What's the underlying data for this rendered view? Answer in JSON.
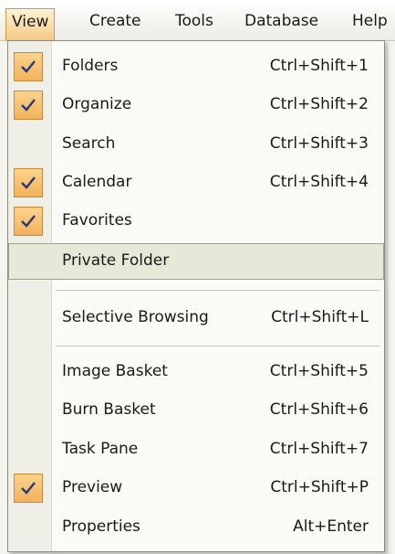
{
  "menubar": {
    "items": [
      {
        "label": "View"
      },
      {
        "label": "Create"
      },
      {
        "label": "Tools"
      },
      {
        "label": "Database"
      },
      {
        "label": "Help"
      }
    ]
  },
  "menu": {
    "items": [
      {
        "label": "Folders",
        "shortcut": "Ctrl+Shift+1",
        "checked": true
      },
      {
        "label": "Organize",
        "shortcut": "Ctrl+Shift+2",
        "checked": true
      },
      {
        "label": "Search",
        "shortcut": "Ctrl+Shift+3",
        "checked": false
      },
      {
        "label": "Calendar",
        "shortcut": "Ctrl+Shift+4",
        "checked": true
      },
      {
        "label": "Favorites",
        "shortcut": "",
        "checked": true
      },
      {
        "label": "Private Folder",
        "shortcut": "",
        "checked": false,
        "highlighted": true
      },
      {
        "label": "Selective Browsing",
        "shortcut": "Ctrl+Shift+L",
        "checked": false
      },
      {
        "label": "Image Basket",
        "shortcut": "Ctrl+Shift+5",
        "checked": false
      },
      {
        "label": "Burn Basket",
        "shortcut": "Ctrl+Shift+6",
        "checked": false
      },
      {
        "label": "Task Pane",
        "shortcut": "Ctrl+Shift+7",
        "checked": false
      },
      {
        "label": "Preview",
        "shortcut": "Ctrl+Shift+P",
        "checked": true
      },
      {
        "label": "Properties",
        "shortcut": "Alt+Enter",
        "checked": false
      }
    ]
  },
  "colors": {
    "accent": "#f2b25c",
    "highlight": "#e6e8d8"
  }
}
